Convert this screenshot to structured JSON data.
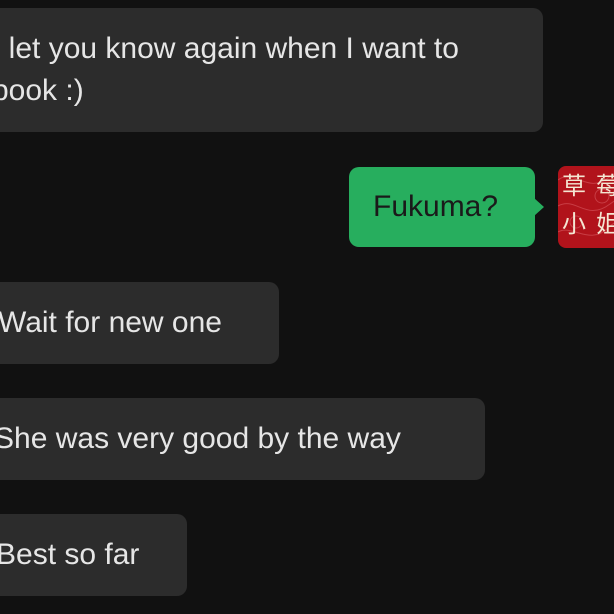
{
  "chat": {
    "messages": [
      {
        "side": "incoming",
        "text": "I let you know again when I want to book :)"
      },
      {
        "side": "outgoing",
        "text": "Fukuma?"
      },
      {
        "side": "incoming",
        "text": "Wait for new one"
      },
      {
        "side": "incoming",
        "text": "She was very good by the way"
      },
      {
        "side": "incoming",
        "text": "Best so far"
      }
    ],
    "avatar": {
      "icon": "contact-avatar-icon",
      "glyphs": [
        "草",
        "莓",
        "小",
        "姐"
      ]
    }
  },
  "colors": {
    "background": "#111111",
    "incoming_bubble": "#2c2c2c",
    "outgoing_bubble": "#27ae5e",
    "avatar_bg": "#b1131b"
  }
}
